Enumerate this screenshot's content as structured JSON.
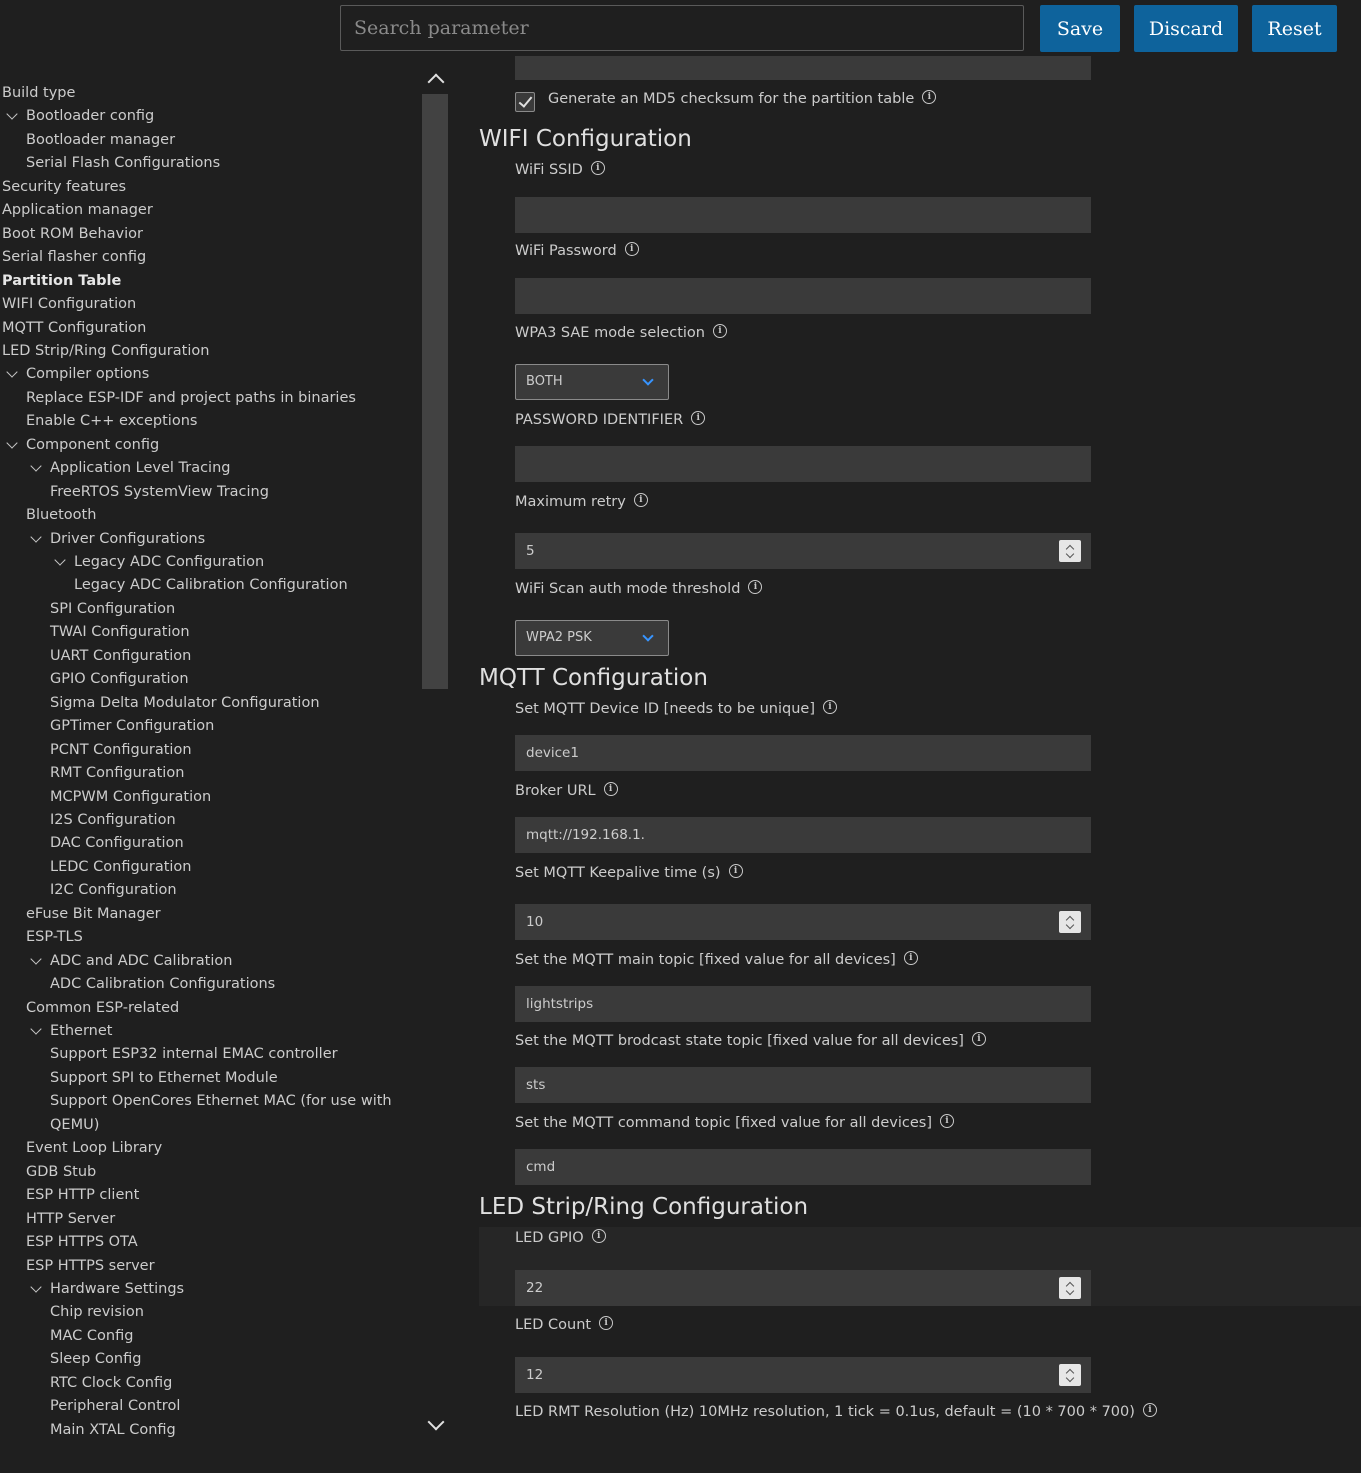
{
  "toolbar": {
    "search_placeholder": "Search parameter",
    "save_label": "Save",
    "discard_label": "Discard",
    "reset_label": "Reset"
  },
  "sidebar": {
    "items": [
      {
        "label": "Build type",
        "depth": 0,
        "expanded": null,
        "active": false
      },
      {
        "label": "Bootloader config",
        "depth": 1,
        "expanded": true,
        "active": false
      },
      {
        "label": "Bootloader manager",
        "depth": 1,
        "expanded": null,
        "active": false
      },
      {
        "label": "Serial Flash Configurations",
        "depth": 1,
        "expanded": null,
        "active": false
      },
      {
        "label": "Security features",
        "depth": 0,
        "expanded": null,
        "active": false
      },
      {
        "label": "Application manager",
        "depth": 0,
        "expanded": null,
        "active": false
      },
      {
        "label": "Boot ROM Behavior",
        "depth": 0,
        "expanded": null,
        "active": false
      },
      {
        "label": "Serial flasher config",
        "depth": 0,
        "expanded": null,
        "active": false
      },
      {
        "label": "Partition Table",
        "depth": 0,
        "expanded": null,
        "active": true
      },
      {
        "label": "WIFI Configuration",
        "depth": 0,
        "expanded": null,
        "active": false
      },
      {
        "label": "MQTT Configuration",
        "depth": 0,
        "expanded": null,
        "active": false
      },
      {
        "label": "LED Strip/Ring Configuration",
        "depth": 0,
        "expanded": null,
        "active": false
      },
      {
        "label": "Compiler options",
        "depth": 1,
        "expanded": true,
        "active": false
      },
      {
        "label": "Replace ESP-IDF and project paths in binaries",
        "depth": 1,
        "expanded": null,
        "active": false
      },
      {
        "label": "Enable C++ exceptions",
        "depth": 1,
        "expanded": null,
        "active": false
      },
      {
        "label": "Component config",
        "depth": 1,
        "expanded": true,
        "active": false
      },
      {
        "label": "Application Level Tracing",
        "depth": 2,
        "expanded": true,
        "active": false
      },
      {
        "label": "FreeRTOS SystemView Tracing",
        "depth": 2,
        "expanded": null,
        "active": false
      },
      {
        "label": "Bluetooth",
        "depth": 1,
        "expanded": null,
        "active": false
      },
      {
        "label": "Driver Configurations",
        "depth": 2,
        "expanded": true,
        "active": false
      },
      {
        "label": "Legacy ADC Configuration",
        "depth": 3,
        "expanded": true,
        "active": false
      },
      {
        "label": "Legacy ADC Calibration Configuration",
        "depth": 3,
        "expanded": null,
        "active": false
      },
      {
        "label": "SPI Configuration",
        "depth": 2,
        "expanded": null,
        "active": false
      },
      {
        "label": "TWAI Configuration",
        "depth": 2,
        "expanded": null,
        "active": false
      },
      {
        "label": "UART Configuration",
        "depth": 2,
        "expanded": null,
        "active": false
      },
      {
        "label": "GPIO Configuration",
        "depth": 2,
        "expanded": null,
        "active": false
      },
      {
        "label": "Sigma Delta Modulator Configuration",
        "depth": 2,
        "expanded": null,
        "active": false
      },
      {
        "label": "GPTimer Configuration",
        "depth": 2,
        "expanded": null,
        "active": false
      },
      {
        "label": "PCNT Configuration",
        "depth": 2,
        "expanded": null,
        "active": false
      },
      {
        "label": "RMT Configuration",
        "depth": 2,
        "expanded": null,
        "active": false
      },
      {
        "label": "MCPWM Configuration",
        "depth": 2,
        "expanded": null,
        "active": false
      },
      {
        "label": "I2S Configuration",
        "depth": 2,
        "expanded": null,
        "active": false
      },
      {
        "label": "DAC Configuration",
        "depth": 2,
        "expanded": null,
        "active": false
      },
      {
        "label": "LEDC Configuration",
        "depth": 2,
        "expanded": null,
        "active": false
      },
      {
        "label": "I2C Configuration",
        "depth": 2,
        "expanded": null,
        "active": false
      },
      {
        "label": "eFuse Bit Manager",
        "depth": 1,
        "expanded": null,
        "active": false
      },
      {
        "label": "ESP-TLS",
        "depth": 1,
        "expanded": null,
        "active": false
      },
      {
        "label": "ADC and ADC Calibration",
        "depth": 2,
        "expanded": true,
        "active": false
      },
      {
        "label": "ADC Calibration Configurations",
        "depth": 2,
        "expanded": null,
        "active": false
      },
      {
        "label": "Common ESP-related",
        "depth": 1,
        "expanded": null,
        "active": false
      },
      {
        "label": "Ethernet",
        "depth": 2,
        "expanded": true,
        "active": false
      },
      {
        "label": "Support ESP32 internal EMAC controller",
        "depth": 2,
        "expanded": null,
        "active": false
      },
      {
        "label": "Support SPI to Ethernet Module",
        "depth": 2,
        "expanded": null,
        "active": false
      },
      {
        "label": "Support OpenCores Ethernet MAC (for use with",
        "depth": 2,
        "expanded": null,
        "active": false
      },
      {
        "label": "QEMU)",
        "depth": 2,
        "expanded": null,
        "active": false
      },
      {
        "label": "Event Loop Library",
        "depth": 1,
        "expanded": null,
        "active": false
      },
      {
        "label": "GDB Stub",
        "depth": 1,
        "expanded": null,
        "active": false
      },
      {
        "label": "ESP HTTP client",
        "depth": 1,
        "expanded": null,
        "active": false
      },
      {
        "label": "HTTP Server",
        "depth": 1,
        "expanded": null,
        "active": false
      },
      {
        "label": "ESP HTTPS OTA",
        "depth": 1,
        "expanded": null,
        "active": false
      },
      {
        "label": "ESP HTTPS server",
        "depth": 1,
        "expanded": null,
        "active": false
      },
      {
        "label": "Hardware Settings",
        "depth": 2,
        "expanded": true,
        "active": false
      },
      {
        "label": "Chip revision",
        "depth": 2,
        "expanded": null,
        "active": false
      },
      {
        "label": "MAC Config",
        "depth": 2,
        "expanded": null,
        "active": false
      },
      {
        "label": "Sleep Config",
        "depth": 2,
        "expanded": null,
        "active": false
      },
      {
        "label": "RTC Clock Config",
        "depth": 2,
        "expanded": null,
        "active": false
      },
      {
        "label": "Peripheral Control",
        "depth": 2,
        "expanded": null,
        "active": false
      },
      {
        "label": "Main XTAL Config",
        "depth": 2,
        "expanded": null,
        "active": false
      }
    ]
  },
  "partition": {
    "md5_label": "Generate an MD5 checksum for the partition table",
    "md5_checked": true
  },
  "wifi": {
    "title": "WIFI Configuration",
    "ssid_label": "WiFi SSID",
    "ssid_value": "",
    "password_label": "WiFi Password",
    "password_value": "",
    "sae_label": "WPA3 SAE mode selection",
    "sae_value": "BOTH",
    "pwid_label": "PASSWORD IDENTIFIER",
    "pwid_value": "",
    "retry_label": "Maximum retry",
    "retry_value": "5",
    "auth_label": "WiFi Scan auth mode threshold",
    "auth_value": "WPA2 PSK"
  },
  "mqtt": {
    "title": "MQTT Configuration",
    "device_id_label": "Set MQTT Device ID [needs to be unique]",
    "device_id_value": "device1",
    "broker_label": "Broker URL",
    "broker_value": "mqtt://192.168.1.",
    "keepalive_label": "Set MQTT Keepalive time (s)",
    "keepalive_value": "10",
    "main_topic_label": "Set the MQTT main topic [fixed value for all devices]",
    "main_topic_value": "lightstrips",
    "state_topic_label": "Set the MQTT brodcast state topic [fixed value for all devices]",
    "state_topic_value": "sts",
    "cmd_topic_label": "Set the MQTT command topic [fixed value for all devices]",
    "cmd_topic_value": "cmd"
  },
  "led": {
    "title": "LED Strip/Ring Configuration",
    "gpio_label": "LED GPIO",
    "gpio_value": "22",
    "count_label": "LED Count",
    "count_value": "12",
    "rmt_label": "LED RMT Resolution (Hz) 10MHz resolution, 1 tick = 0.1us, default = (10 * 700 * 700)"
  },
  "icons": {
    "info": "i"
  },
  "colors": {
    "background": "#1f1f1f",
    "accent": "#0e639c",
    "input": "#3a3a3a",
    "select_caret": "#3794ff"
  }
}
